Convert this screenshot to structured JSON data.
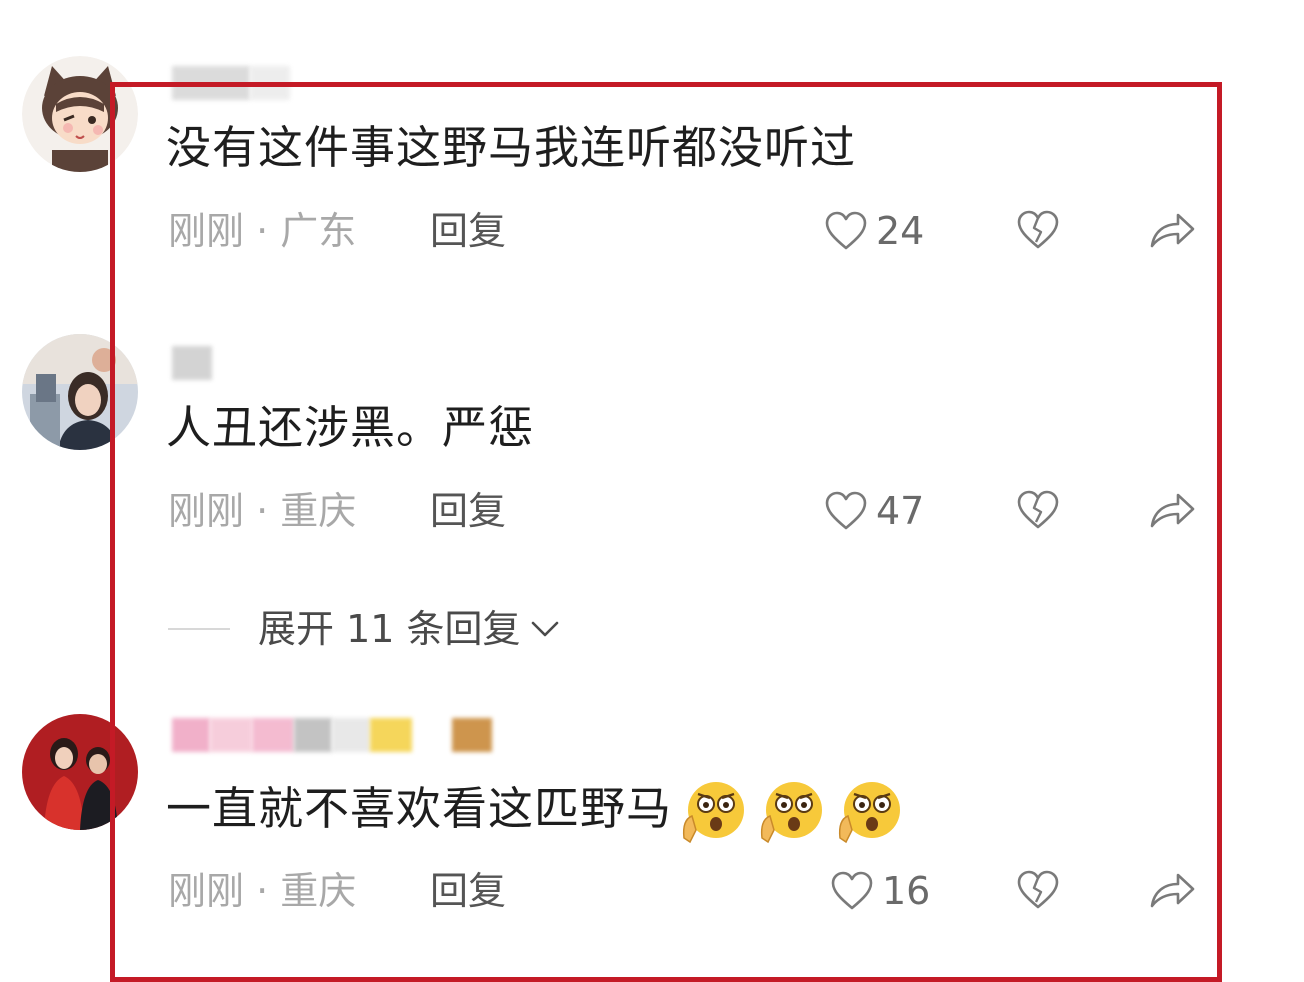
{
  "comments": [
    {
      "text": "没有这件事这野马我连听都没听过",
      "time_location": "刚刚 · 广东",
      "reply_label": "回复",
      "likes": "24",
      "avatar": "cat-girl-avatar"
    },
    {
      "text": "人丑还涉黑。严惩",
      "time_location": "刚刚 · 重庆",
      "reply_label": "回复",
      "likes": "47",
      "avatar": "photo-avatar"
    },
    {
      "text": "一直就不喜欢看这匹野马",
      "time_location": "刚刚 · 重庆",
      "reply_label": "回复",
      "likes": "16",
      "avatar": "couple-photo-avatar",
      "emojis": [
        "shocked-face-emoji",
        "shocked-face-emoji",
        "shocked-face-emoji"
      ]
    }
  ],
  "expand_replies": {
    "label": "展开 11 条回复"
  },
  "icons": {
    "like": "heart-outline-icon",
    "dislike": "broken-heart-icon",
    "share": "share-arrow-icon",
    "expand": "chevron-down-icon"
  },
  "colors": {
    "highlight_border": "#c41a26",
    "meta_gray": "#a8a8a8",
    "text_dark": "#1e1e1e"
  }
}
